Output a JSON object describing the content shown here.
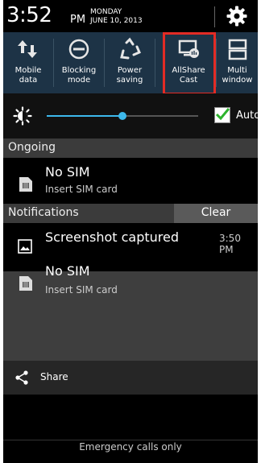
{
  "status": {
    "time": "3:52",
    "ampm": "PM",
    "day": "MONDAY",
    "date": "JUNE 10, 2013",
    "settings_icon": "gear-icon"
  },
  "quick_settings": [
    {
      "label_line1": "Mobile",
      "label_line2": "data",
      "icon": "mobile-data-icon"
    },
    {
      "label_line1": "Blocking",
      "label_line2": "mode",
      "icon": "blocking-mode-icon"
    },
    {
      "label_line1": "Power",
      "label_line2": "saving",
      "icon": "power-saving-icon"
    },
    {
      "label_line1": "AllShare",
      "label_line2": "Cast",
      "icon": "allshare-cast-icon"
    },
    {
      "label_line1": "Multi",
      "label_line2": "window",
      "icon": "multi-window-icon"
    }
  ],
  "brightness": {
    "level": 0.5,
    "auto_label": "Auto",
    "auto_checked": true
  },
  "ongoing": {
    "header": "Ongoing",
    "items": [
      {
        "title": "No SIM",
        "subtitle": "Insert SIM card",
        "icon": "sim-card-icon"
      }
    ]
  },
  "notifications": {
    "header": "Notifications",
    "clear_label": "Clear",
    "items": [
      {
        "title": "Screenshot captured",
        "time": "3:50 PM",
        "icon": "image-icon"
      },
      {
        "title": "No SIM",
        "subtitle": "Insert SIM card",
        "icon": "sim-card-icon"
      }
    ]
  },
  "share": {
    "label": "Share",
    "icon": "share-icon"
  },
  "footer": {
    "emergency_text": "Emergency calls only"
  },
  "colors": {
    "accent": "#3db9ec",
    "quick_settings_bg": "#1d3346",
    "highlight": "#e32b25",
    "checkbox_check": "#2db32d"
  }
}
